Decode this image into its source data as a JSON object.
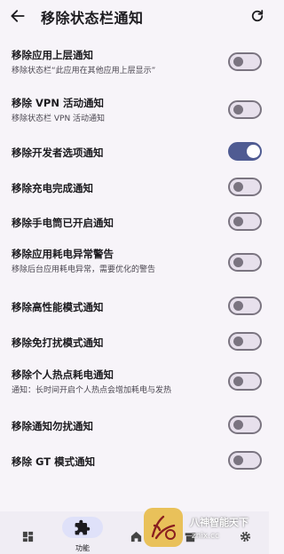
{
  "header": {
    "title": "移除状态栏通知",
    "back_icon": "arrow-left-icon",
    "refresh_icon": "refresh-icon"
  },
  "settings": [
    {
      "title": "移除应用上层通知",
      "subtitle": "移除状态栏“此应用在其他应用上层显示”",
      "enabled": false
    },
    {
      "title": "移除 VPN 活动通知",
      "subtitle": "移除状态栏 VPN 活动通知",
      "enabled": false
    },
    {
      "title": "移除开发者选项通知",
      "subtitle": "",
      "enabled": true
    },
    {
      "title": "移除充电完成通知",
      "subtitle": "",
      "enabled": false
    },
    {
      "title": "移除手电筒已开启通知",
      "subtitle": "",
      "enabled": false
    },
    {
      "title": "移除应用耗电异常警告",
      "subtitle": "移除后台应用耗电异常，需要优化的警告",
      "enabled": false
    },
    {
      "title": "移除高性能模式通知",
      "subtitle": "",
      "enabled": false
    },
    {
      "title": "移除免打扰模式通知",
      "subtitle": "",
      "enabled": false
    },
    {
      "title": "移除个人热点耗电通知",
      "subtitle": "通知：长时间开启个人热点会增加耗电与发热",
      "enabled": false
    },
    {
      "title": "移除通知勿扰通知",
      "subtitle": "",
      "enabled": false
    },
    {
      "title": "移除 GT 模式通知",
      "subtitle": "",
      "enabled": false
    }
  ],
  "bottom_nav": {
    "items": [
      {
        "icon": "dashboard-icon",
        "label": ""
      },
      {
        "icon": "puzzle-icon",
        "label": "功能",
        "active": true
      },
      {
        "icon": "home-icon",
        "label": ""
      },
      {
        "icon": "archive-icon",
        "label": ""
      },
      {
        "icon": "gear-icon",
        "label": ""
      }
    ]
  },
  "watermark": {
    "text": "八神智能天下",
    "domain": "znix.cc"
  },
  "colors": {
    "background": "#f7f4f9",
    "switch_on": "#4f5b92",
    "switch_off_track": "#e7e0ec",
    "switch_off_border": "#7a7480",
    "nav_active_pill": "#dfe1f9"
  }
}
